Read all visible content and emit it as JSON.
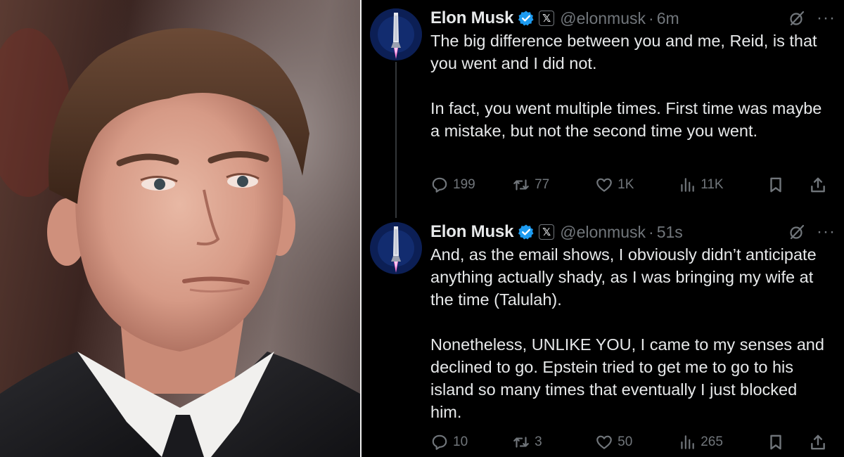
{
  "tweets": [
    {
      "name": "Elon Musk",
      "badge": "𝕏",
      "handle": "@elonmusk",
      "separator": "·",
      "time": "6m",
      "more": "···",
      "paragraphs": [
        "The big difference between you and me, Reid, is that you went and I did not.",
        "In fact, you went multiple times. First time was maybe a mistake, but not the second time you went."
      ],
      "stats": {
        "replies": "199",
        "reposts": "77",
        "likes": "1K",
        "views": "11K"
      }
    },
    {
      "name": "Elon Musk",
      "badge": "𝕏",
      "handle": "@elonmusk",
      "separator": "·",
      "time": "51s",
      "more": "···",
      "paragraphs": [
        "And, as the email shows, I obviously didn’t anticipate anything actually shady, as I was bringing my wife at the time (Talulah).",
        "Nonetheless, UNLIKE YOU, I came to my senses and declined to go. Epstein tried to get me to go to his island so many times that eventually I just blocked him."
      ],
      "stats": {
        "replies": "10",
        "reposts": "3",
        "likes": "50",
        "views": "265"
      }
    }
  ],
  "colors": {
    "background": "#000000",
    "text": "#e7e9ea",
    "muted": "#71767b",
    "verified": "#1d9bf0",
    "thread_line": "#333639"
  },
  "icons": [
    "verified-icon",
    "x-badge-icon",
    "grok-icon",
    "more-icon",
    "reply-icon",
    "repost-icon",
    "like-icon",
    "views-icon",
    "bookmark-icon",
    "share-icon"
  ]
}
